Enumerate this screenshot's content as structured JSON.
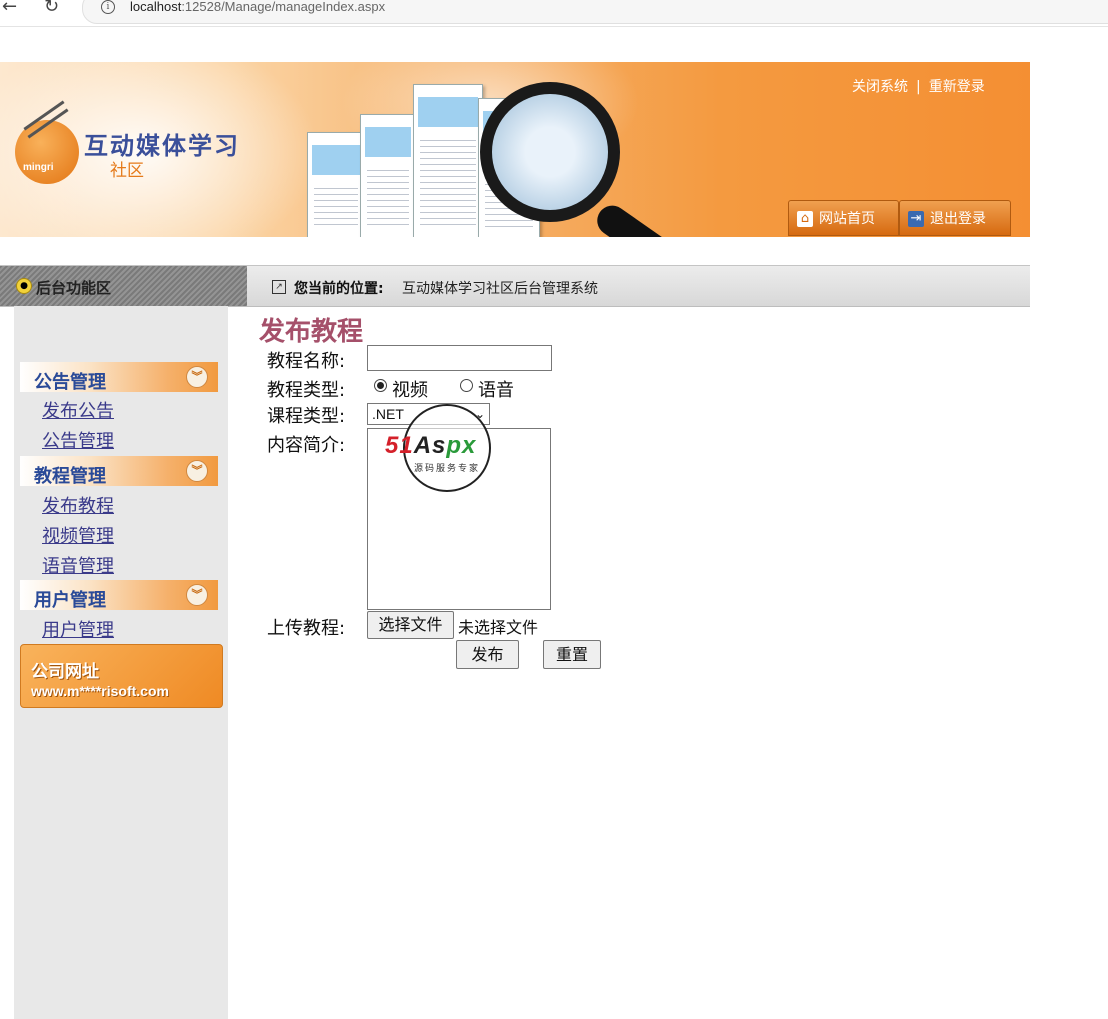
{
  "browser": {
    "url_host": "localhost",
    "url_rest": ":12528/Manage/manageIndex.aspx"
  },
  "banner": {
    "logo_brand": "mingri",
    "logo_title": "互动媒体学习",
    "logo_subtitle": "社区",
    "top_links": {
      "close": "关闭系统",
      "sep": "|",
      "relogin": "重新登录"
    },
    "buttons": {
      "home": "网站首页",
      "logout": "退出登录"
    }
  },
  "strip": {
    "left_label": "后台功能区",
    "location_label": "您当前的位置:",
    "location_text": "互动媒体学习社区后台管理系统"
  },
  "sidebar": {
    "groups": [
      {
        "label": "公告管理",
        "items": [
          "发布公告",
          "公告管理"
        ]
      },
      {
        "label": "教程管理",
        "items": [
          "发布教程",
          "视频管理",
          "语音管理"
        ]
      },
      {
        "label": "用户管理",
        "items": [
          "用户管理"
        ]
      }
    ],
    "promo": {
      "title": "公司网址",
      "url": "www.m****risoft.com"
    }
  },
  "form": {
    "title": "发布教程",
    "name_label": "教程名称:",
    "name_value": "",
    "type_label": "教程类型:",
    "type_options": [
      "视频",
      "语音"
    ],
    "type_selected": "视频",
    "course_label": "课程类型:",
    "course_value": ".NET",
    "intro_label": "内容简介:",
    "upload_label": "上传教程:",
    "choose_file": "选择文件",
    "no_file": "未选择文件",
    "submit": "发布",
    "reset": "重置"
  },
  "watermark": {
    "brand_red": "51",
    "brand_black": "As",
    "brand_green": "px",
    "subtitle": "源码服务专家"
  }
}
